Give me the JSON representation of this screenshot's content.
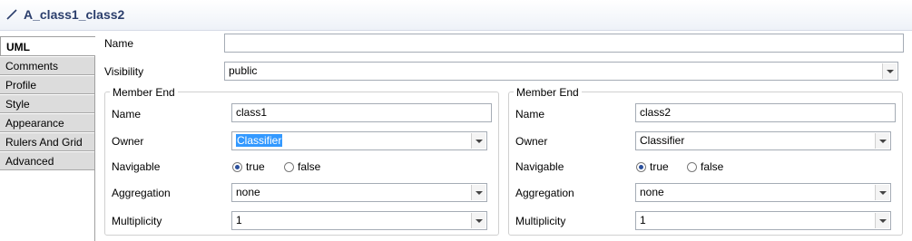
{
  "header": {
    "title": "A_class1_class2"
  },
  "tabs": [
    {
      "label": "UML"
    },
    {
      "label": "Comments"
    },
    {
      "label": "Profile"
    },
    {
      "label": "Style"
    },
    {
      "label": "Appearance"
    },
    {
      "label": "Rulers And Grid"
    },
    {
      "label": "Advanced"
    }
  ],
  "form": {
    "name_label": "Name",
    "name_value": "",
    "visibility_label": "Visibility",
    "visibility_value": "public"
  },
  "member_ends": [
    {
      "title": "Member End",
      "name_label": "Name",
      "name_value": "class1",
      "owner_label": "Owner",
      "owner_value": "Classifier",
      "navigable_label": "Navigable",
      "navigable_true": "true",
      "navigable_false": "false",
      "navigable_selected": "true",
      "aggregation_label": "Aggregation",
      "aggregation_value": "none",
      "multiplicity_label": "Multiplicity",
      "multiplicity_value": "1"
    },
    {
      "title": "Member End",
      "name_label": "Name",
      "name_value": "class2",
      "owner_label": "Owner",
      "owner_value": "Classifier",
      "navigable_label": "Navigable",
      "navigable_true": "true",
      "navigable_false": "false",
      "navigable_selected": "true",
      "aggregation_label": "Aggregation",
      "aggregation_value": "none",
      "multiplicity_label": "Multiplicity",
      "multiplicity_value": "1"
    }
  ]
}
